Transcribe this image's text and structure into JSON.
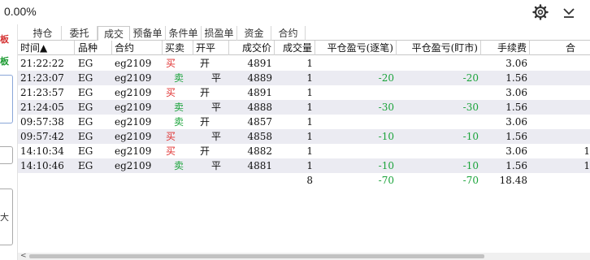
{
  "header": {
    "percent": "0.00%",
    "settings_icon": "gear-icon",
    "collapse_icon": "chevron-down-icon"
  },
  "sidebar": {
    "label_1": "板",
    "label_2": "板",
    "label_3": "大"
  },
  "tabs": [
    {
      "label": "持仓"
    },
    {
      "label": "委托"
    },
    {
      "label": "成交",
      "active": true
    },
    {
      "label": "预备单"
    },
    {
      "label": "条件单"
    },
    {
      "label": "损盈单"
    },
    {
      "label": "资金"
    },
    {
      "label": "合约"
    }
  ],
  "table": {
    "columns": [
      "时间▲",
      "品种",
      "合约",
      "买卖",
      "开平",
      "成交价",
      "成交量",
      "平仓盈亏(逐笔)",
      "平仓盈亏(盯市)",
      "手续费",
      "合"
    ],
    "rows": [
      {
        "time": "21:22:22",
        "variety": "EG",
        "contract": "eg2109",
        "side": "买",
        "openclose": "开",
        "price": "4891",
        "qty": "1",
        "pnl_trade": "",
        "pnl_mark": "",
        "fee": "3.06",
        "extra": ""
      },
      {
        "time": "21:23:07",
        "variety": "EG",
        "contract": "eg2109",
        "side": "卖",
        "openclose": "平",
        "price": "4889",
        "qty": "1",
        "pnl_trade": "-20",
        "pnl_mark": "-20",
        "fee": "1.56",
        "extra": ""
      },
      {
        "time": "21:23:57",
        "variety": "EG",
        "contract": "eg2109",
        "side": "买",
        "openclose": "开",
        "price": "4891",
        "qty": "1",
        "pnl_trade": "",
        "pnl_mark": "",
        "fee": "3.06",
        "extra": ""
      },
      {
        "time": "21:24:05",
        "variety": "EG",
        "contract": "eg2109",
        "side": "卖",
        "openclose": "平",
        "price": "4888",
        "qty": "1",
        "pnl_trade": "-30",
        "pnl_mark": "-30",
        "fee": "1.56",
        "extra": ""
      },
      {
        "time": "09:57:38",
        "variety": "EG",
        "contract": "eg2109",
        "side": "卖",
        "openclose": "开",
        "price": "4857",
        "qty": "1",
        "pnl_trade": "",
        "pnl_mark": "",
        "fee": "3.06",
        "extra": ""
      },
      {
        "time": "09:57:42",
        "variety": "EG",
        "contract": "eg2109",
        "side": "买",
        "openclose": "平",
        "price": "4858",
        "qty": "1",
        "pnl_trade": "-10",
        "pnl_mark": "-10",
        "fee": "1.56",
        "extra": ""
      },
      {
        "time": "14:10:34",
        "variety": "EG",
        "contract": "eg2109",
        "side": "买",
        "openclose": "开",
        "price": "4882",
        "qty": "1",
        "pnl_trade": "",
        "pnl_mark": "",
        "fee": "3.06",
        "extra": "1"
      },
      {
        "time": "14:10:46",
        "variety": "EG",
        "contract": "eg2109",
        "side": "卖",
        "openclose": "平",
        "price": "4881",
        "qty": "1",
        "pnl_trade": "-10",
        "pnl_mark": "-10",
        "fee": "1.56",
        "extra": "1"
      }
    ],
    "summary": {
      "qty": "8",
      "pnl_trade": "-70",
      "pnl_mark": "-70",
      "fee": "18.48"
    }
  },
  "colors": {
    "buy": "#e03030",
    "sell": "#1aa33a",
    "row_alt": "#ebebf2"
  }
}
